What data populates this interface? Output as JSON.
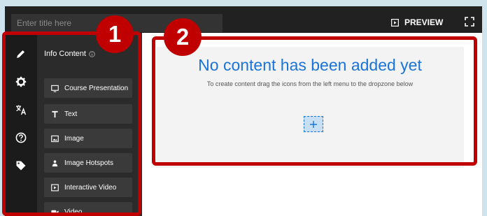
{
  "header": {
    "title_placeholder": "Enter title here",
    "preview_label": "PREVIEW"
  },
  "rail": {
    "items": [
      {
        "icon": "pencil-icon"
      },
      {
        "icon": "gear-icon"
      },
      {
        "icon": "translate-icon"
      },
      {
        "icon": "help-icon"
      },
      {
        "icon": "tag-icon"
      }
    ]
  },
  "panel": {
    "heading": "Info Content",
    "items": [
      {
        "label": "Course Presentation",
        "icon": "presentation-icon"
      },
      {
        "label": "Text",
        "icon": "text-icon"
      },
      {
        "label": "Image",
        "icon": "image-icon"
      },
      {
        "label": "Image Hotspots",
        "icon": "hotspot-icon"
      },
      {
        "label": "Interactive Video",
        "icon": "interactive-video-icon"
      },
      {
        "label": "Video",
        "icon": "video-icon"
      }
    ]
  },
  "dropzone": {
    "title": "No content has been added yet",
    "subtitle": "To create content drag the icons from the left menu to the dropzone below"
  },
  "callouts": [
    {
      "label": "1"
    },
    {
      "label": "2"
    }
  ],
  "colors": {
    "topbar": "#212121",
    "rail": "#1b1b1b",
    "panel": "#2b2b2b",
    "button": "#3a3a3a",
    "accent": "#1a73d9",
    "callout": "#c00000",
    "outer_bg": "#cfe3ec"
  }
}
